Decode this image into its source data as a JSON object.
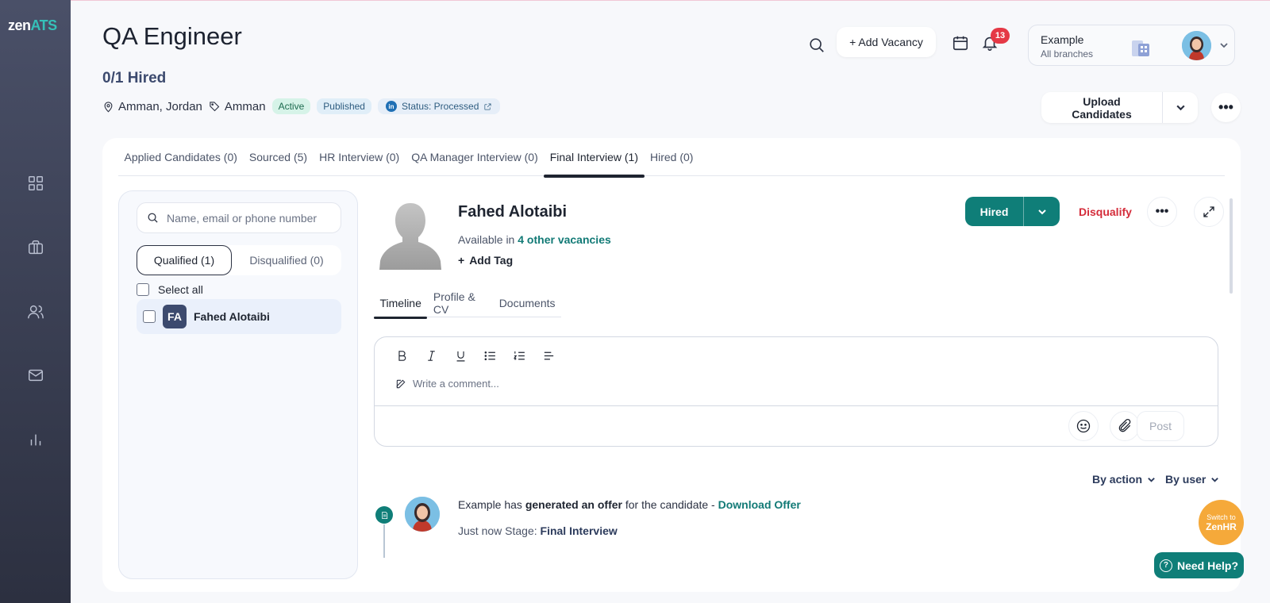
{
  "sidebar": {
    "logo_a": "zen",
    "logo_b": "ATS",
    "items": [
      {
        "icon": "dashboard-grid-icon"
      },
      {
        "icon": "briefcase-icon"
      },
      {
        "icon": "users-icon"
      },
      {
        "icon": "mail-icon"
      },
      {
        "icon": "bar-chart-icon"
      }
    ]
  },
  "header": {
    "title": "QA Engineer",
    "hired_count": "0/1 Hired",
    "location": "Amman, Jordan",
    "tag": "Amman",
    "badge_active": "Active",
    "badge_published": "Published",
    "linkedin_letter": "in",
    "status": "Status: Processed",
    "add_vacancy": "+ Add Vacancy",
    "notifications": "13",
    "account_name": "Example",
    "account_sub": "All branches",
    "upload": "Upload Candidates"
  },
  "stage_tabs": [
    {
      "label": "Applied Candidates (0)"
    },
    {
      "label": "Sourced (5)"
    },
    {
      "label": "HR Interview (0)"
    },
    {
      "label": "QA Manager Interview (0)"
    },
    {
      "label": "Final Interview (1)",
      "active": true
    },
    {
      "label": "Hired (0)"
    }
  ],
  "list": {
    "search_placeholder": "Name, email or phone number",
    "qualified": "Qualified (1)",
    "disqualified": "Disqualified (0)",
    "select_all": "Select all",
    "candidates": [
      {
        "initials": "FA",
        "name": "Fahed Alotaibi"
      }
    ]
  },
  "candidate": {
    "name": "Fahed Alotaibi",
    "available_prefix": "Available in",
    "available_link": "4 other vacancies",
    "add_tag": "Add Tag",
    "hired": "Hired",
    "disqualify": "Disqualify",
    "tabs": [
      "Timeline",
      "Profile & CV",
      "Documents"
    ]
  },
  "editor": {
    "placeholder": "Write a comment...",
    "post": "Post"
  },
  "filters": {
    "by_action": "By action",
    "by_user": "By user"
  },
  "timeline": [
    {
      "actor": "Example",
      "verb_pre": "has",
      "action": "generated an offer",
      "suffix": "for the candidate -",
      "link": "Download Offer",
      "time": "Just now",
      "stage_label": "Stage:",
      "stage": "Final Interview"
    }
  ],
  "widgets": {
    "switch_line1": "Switch to",
    "switch_line2": "ZenHR",
    "help": "Need Help?",
    "help_glyph": "?"
  },
  "colors": {
    "brand_teal": "#0f7e78",
    "danger": "#d42c3a",
    "sidebar": "#3c4258",
    "accent_orange": "#f5a93a"
  }
}
